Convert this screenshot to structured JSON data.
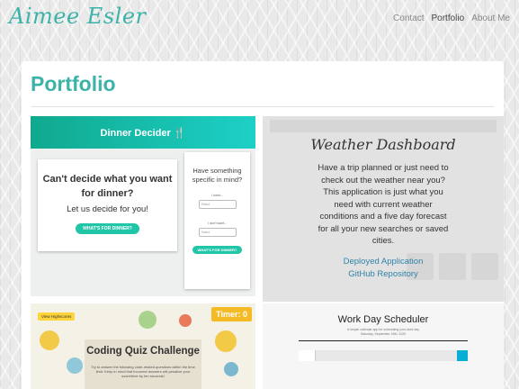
{
  "header": {
    "logo": "Aimee Esler",
    "nav": [
      {
        "label": "Contact",
        "active": false
      },
      {
        "label": "Portfolio",
        "active": true
      },
      {
        "label": "About Me",
        "active": false
      }
    ]
  },
  "page": {
    "title": "Portfolio"
  },
  "projects": {
    "dinner": {
      "bar_title": "Dinner Decider 🍴",
      "question": "Can't decide what you want for dinner?",
      "subtitle": "Let us decide for you!",
      "button": "WHAT'S FOR DINNER?",
      "side_heading": "Have something specific in mind?",
      "want_label": "I want...",
      "dont_want_label": "I don't want...",
      "select_placeholder": "Select",
      "side_button": "WHAT'S FOR DINNER?"
    },
    "weather": {
      "title": "Weather Dashboard",
      "description": "Have a trip planned or just need to check out the weather near you? This application is just what you need with current weather conditions and a five day forecast for all your new searches or saved cities.",
      "links": [
        "Deployed Application",
        "GitHub Repository"
      ]
    },
    "quiz": {
      "highscores": "View Highscores",
      "timer": "Timer: 0",
      "title": "Coding Quiz Challenge",
      "text": "Try to answer the following code-related questions within the time limit. Keep in mind that incorrect answers will penalize your score/time by ten seconds!"
    },
    "workday": {
      "title": "Work Day Scheduler",
      "subtitle": "A simple calendar app for scheduling your work day",
      "date": "Saturday, September 19th, 2020"
    }
  },
  "colors": {
    "accent": "#3bb3a8",
    "link": "#2f84a8",
    "timer": "#f5bb27"
  }
}
